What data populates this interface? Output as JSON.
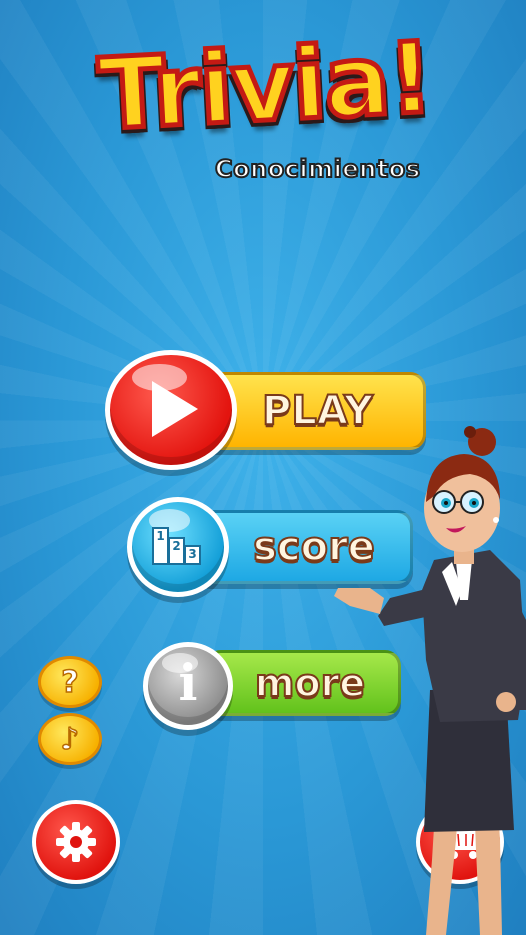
{
  "app": {
    "title": "Trivia!",
    "subtitle": "Conocimientos"
  },
  "menu": {
    "play_label": "PLAY",
    "score_label": "score",
    "more_label": "more"
  },
  "side_buttons": {
    "help_glyph": "?",
    "sound_glyph": "♪"
  },
  "icons": {
    "play": "play-triangle-icon",
    "score": "podium-icon",
    "more": "info-icon",
    "help": "question-icon",
    "sound": "music-note-icon",
    "settings": "gear-icon",
    "shop": "shopping-cart-icon"
  },
  "podium_numbers": [
    "1",
    "2",
    "3"
  ],
  "colors": {
    "background": "#2a98d6",
    "play_bar": "#ffc21a",
    "play_circle": "#e3140f",
    "score_bar": "#1ea8e4",
    "more_bar": "#62c21c",
    "more_circle": "#8d8d8d",
    "small_buttons": "#f7b100",
    "round_buttons": "#e0130e"
  }
}
